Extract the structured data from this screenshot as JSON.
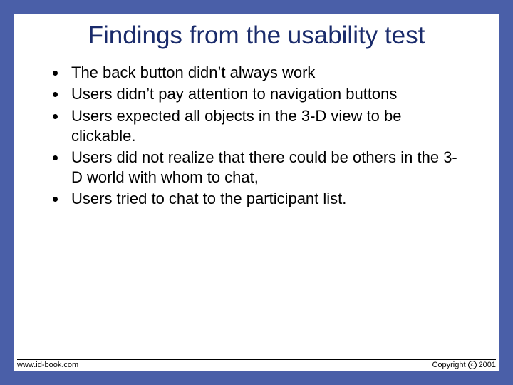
{
  "slide": {
    "title": "Findings from the usability test",
    "bullets": [
      "The back button didn’t always work",
      "Users didn’t pay attention to navigation buttons",
      "Users expected all objects in the 3-D view to be clickable.",
      "Users did not realize that there could be others in the 3-D world with whom to chat,",
      "Users tried to chat to the participant list."
    ]
  },
  "footer": {
    "site": "www.id-book.com",
    "copyright_prefix": "Copyright",
    "copyright_year": "2001"
  }
}
